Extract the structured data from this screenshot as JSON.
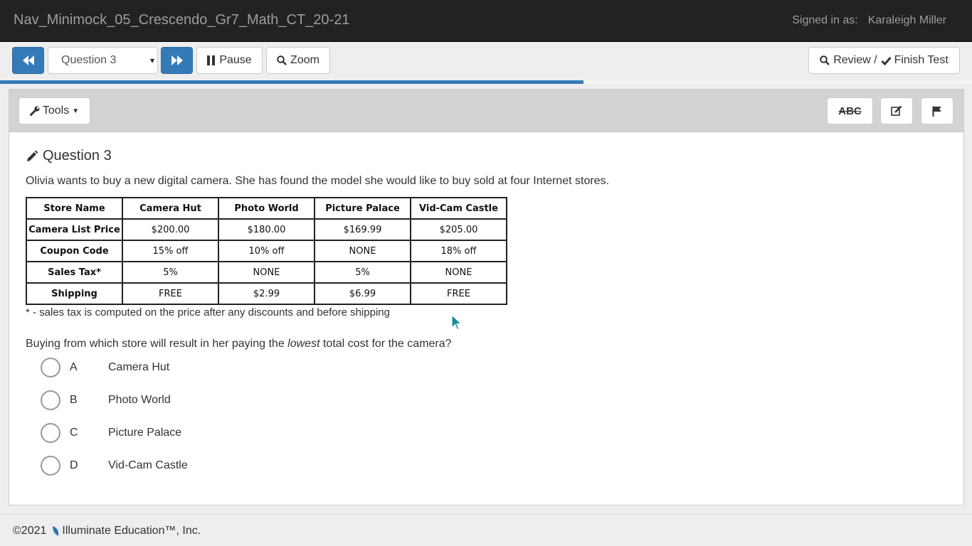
{
  "header": {
    "title": "Nav_Minimock_05_Crescendo_Gr7_Math_CT_20-21",
    "signed_in_label": "Signed in as:",
    "user_name": "Karaleigh Miller"
  },
  "navbar": {
    "prev_icon": "fast-backward-icon",
    "question_select_value": "Question 3",
    "next_icon": "fast-forward-icon",
    "pause_label": "Pause",
    "zoom_label": "Zoom",
    "review_label": "Review /",
    "finish_label": "Finish Test"
  },
  "progress": {
    "fraction": 0.6
  },
  "tools": {
    "tools_label": "Tools",
    "strikethrough_label": "ABC",
    "notes_icon": "edit-icon",
    "flag_icon": "flag-icon"
  },
  "question": {
    "title": "Question 3",
    "stem": "Olivia wants to buy a new digital camera. She has found the model she would like to buy sold at four Internet stores.",
    "table": {
      "headers": [
        "Store Name",
        "Camera Hut",
        "Photo World",
        "Picture Palace",
        "Vid-Cam Castle"
      ],
      "rows": [
        [
          "Camera List Price",
          "$200.00",
          "$180.00",
          "$169.99",
          "$205.00"
        ],
        [
          "Coupon Code",
          "15% off",
          "10% off",
          "NONE",
          "18% off"
        ],
        [
          "Sales Tax*",
          "5%",
          "NONE",
          "5%",
          "NONE"
        ],
        [
          "Shipping",
          "FREE",
          "$2.99",
          "$6.99",
          "FREE"
        ]
      ]
    },
    "note": "* - sales tax is computed on the price after any discounts and before shipping",
    "prompt_before": "Buying from which store will result in her paying the ",
    "prompt_emph": "lowest",
    "prompt_after": " total cost for the camera?",
    "choices": [
      {
        "letter": "A",
        "text": "Camera Hut"
      },
      {
        "letter": "B",
        "text": "Photo World"
      },
      {
        "letter": "C",
        "text": "Picture Palace"
      },
      {
        "letter": "D",
        "text": "Vid-Cam Castle"
      }
    ]
  },
  "footer": {
    "copyright": "©2021",
    "company": "Illuminate Education™, Inc."
  },
  "colors": {
    "primary": "#337ab7",
    "topbar": "#222222"
  }
}
